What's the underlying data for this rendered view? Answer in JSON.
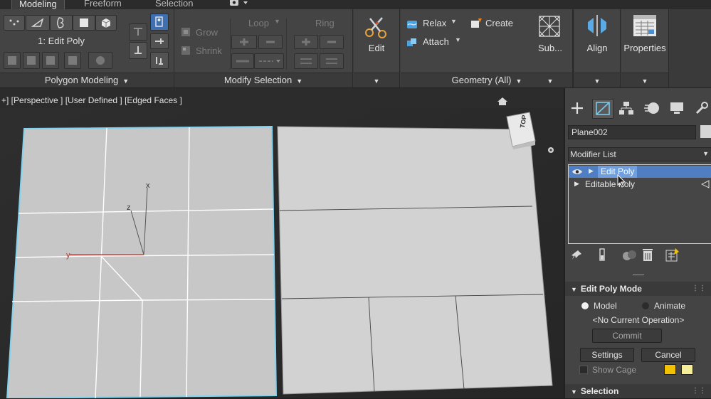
{
  "tabs": [
    {
      "label": "Modeling",
      "active": true
    },
    {
      "label": "Freeform",
      "active": false
    },
    {
      "label": "Selection",
      "active": false
    }
  ],
  "ribbon": {
    "polygon_modeling": {
      "mode_label": "1: Edit Poly",
      "footer": "Polygon Modeling"
    },
    "modify_selection": {
      "grow": "Grow",
      "shrink": "Shrink",
      "loop": "Loop",
      "ring": "Ring",
      "footer": "Modify Selection"
    },
    "edit": {
      "label": "Edit"
    },
    "geometry": {
      "relax": "Relax",
      "create": "Create",
      "attach": "Attach",
      "footer": "Geometry (All)"
    },
    "sub": {
      "label": "Sub..."
    },
    "align": {
      "label": "Align"
    },
    "properties": {
      "label": "Properties"
    }
  },
  "viewport": {
    "label": "+] [Perspective ] [User Defined ] [Edged Faces ]",
    "viewcube": "TOP",
    "axes": {
      "x": "x",
      "y": "y",
      "z": "z"
    }
  },
  "command_panel": {
    "object_name": "Plane002",
    "modifier_list_label": "Modifier List",
    "stack": [
      {
        "label": "Edit Poly",
        "selected": true
      },
      {
        "label": "Editable Poly",
        "selected": false
      }
    ],
    "edit_poly_mode": {
      "title": "Edit Poly Mode",
      "model": "Model",
      "animate": "Animate",
      "current_op": "<No Current Operation>",
      "commit": "Commit",
      "settings": "Settings",
      "cancel": "Cancel",
      "show_cage": "Show Cage"
    },
    "selection_title": "Selection",
    "colors": {
      "cage_1": "#f2c200",
      "cage_2": "#f5ef9a",
      "selected": "#5b8fd6"
    }
  }
}
